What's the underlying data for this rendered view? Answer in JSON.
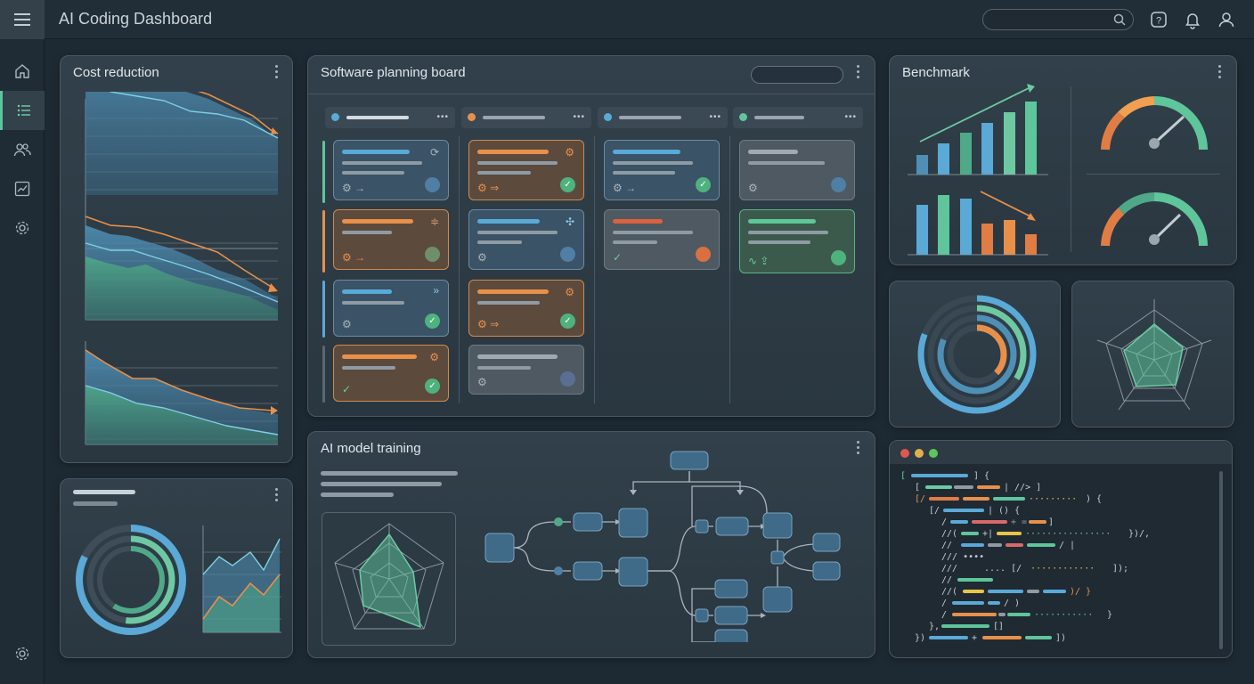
{
  "app": {
    "title": "AI Coding Dashboard",
    "colors": {
      "background": "#1e2a33",
      "accent_green": "#5fc59b",
      "accent_blue": "#5aa9d6",
      "accent_orange": "#e8904a",
      "accent_red": "#d9623f"
    }
  },
  "topbar": {
    "menu_icon": "hamburger-menu-icon",
    "search_icon": "search-icon",
    "help_icon": "help-icon",
    "bell_icon": "bell-icon",
    "user_icon": "user-icon"
  },
  "sidebar": {
    "items": [
      {
        "icon": "home-icon",
        "active": false
      },
      {
        "icon": "list-icon",
        "active": true
      },
      {
        "icon": "users-icon",
        "active": false
      },
      {
        "icon": "chart-icon",
        "active": false
      },
      {
        "icon": "gear-icon",
        "active": false
      }
    ],
    "bottom_icon": "gear-icon"
  },
  "panels": {
    "cost_reduction": {
      "title": "Cost reduction"
    },
    "planning_board": {
      "title": "Software planning board"
    },
    "benchmark": {
      "title": "Benchmark"
    },
    "model_training": {
      "title": "AI model training"
    }
  }
}
